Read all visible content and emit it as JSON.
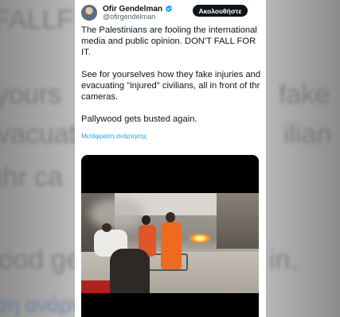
{
  "background": {
    "text_lines_left": [
      "FALLF",
      "yours",
      "vacuati",
      "thr ca",
      "ood ge",
      "ση ανάρτη"
    ],
    "text_lines_right": [
      "fake",
      "ilian",
      "in."
    ]
  },
  "tweet": {
    "author": {
      "display_name": "Ofir Gendelman",
      "handle": "@ofirgendelman",
      "verified": true
    },
    "follow_button_label": "Ακολουθήστε",
    "text_paragraphs": [
      "The Palestinians are fooling the international media and public opinion. DON'T FALL FOR IT.",
      "See for yourselves how they fake injuries and evacuating \"injured\" civilians, all in front of thr cameras.",
      "Pallywood gets busted again."
    ],
    "translate_label": "Μετάφραση ανάρτησης"
  },
  "colors": {
    "link_blue": "#1d9bf0",
    "verified_blue": "#1d9bf0",
    "button_black": "#0f1419",
    "text_primary": "#0f1419",
    "text_secondary": "#536471"
  },
  "icons": {
    "verified": "verified-badge-icon",
    "avatar": "profile-avatar"
  }
}
